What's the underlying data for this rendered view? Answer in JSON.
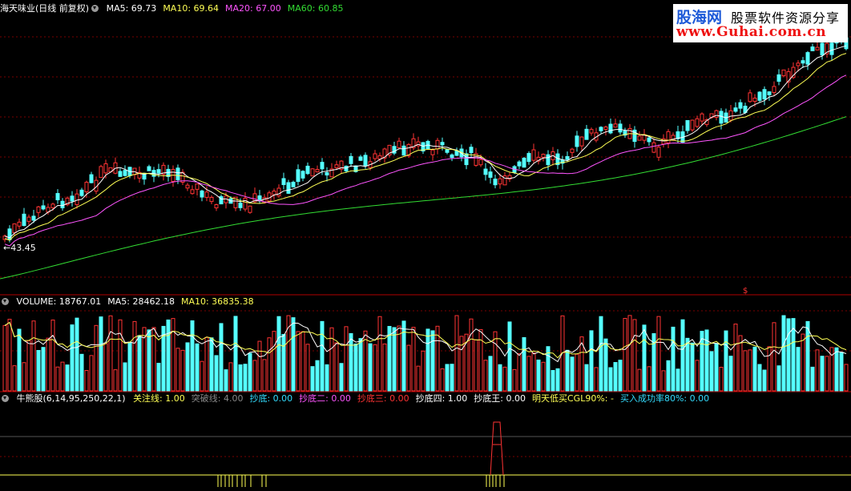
{
  "main_panel": {
    "stock_name": "海天味业(日线 前复权)",
    "indicators": [
      {
        "label": "MA5: 69.73",
        "color": "#ffffff"
      },
      {
        "label": "MA10: 69.64",
        "color": "#ffff55"
      },
      {
        "label": "MA20: 67.00",
        "color": "#ff55ff"
      },
      {
        "label": "MA60: 60.85",
        "color": "#33dd33"
      }
    ],
    "low_price_label": "←43.45"
  },
  "volume_panel": {
    "indicators": [
      {
        "label": "VOLUME: 18767.01",
        "color": "#ffffff"
      },
      {
        "label": "MA5: 28462.18",
        "color": "#ffffff"
      },
      {
        "label": "MA10: 36835.38",
        "color": "#ffff55"
      }
    ]
  },
  "custom_panel": {
    "title": "牛熊股(6,14,95,250,22,1)",
    "indicators": [
      {
        "label": "关注线: 1.00",
        "color": "#ffff55"
      },
      {
        "label": "突破线: 4.00",
        "color": "#888888"
      },
      {
        "label": "抄底: 0.00",
        "color": "#33ddff"
      },
      {
        "label": "抄底二: 0.00",
        "color": "#ff55ff"
      },
      {
        "label": "抄底三: 0.00",
        "color": "#ff3333"
      },
      {
        "label": "抄底四: 1.00",
        "color": "#ffffff"
      },
      {
        "label": "抄底王: 0.00",
        "color": "#ffffff"
      },
      {
        "label": "明天低买CGL90%: -",
        "color": "#ffff55"
      },
      {
        "label": "买入成功率80%: 0.00",
        "color": "#33ddff"
      }
    ]
  },
  "watermark": {
    "line1": "股海网",
    "line2": "股票软件资源分享",
    "line3": "www.Guhai.com.cn"
  },
  "colors": {
    "up_candle": "#ff3333",
    "down_candle": "#55ffff",
    "ma5": "#ffffff",
    "ma10": "#ffff55",
    "ma20": "#ff55ff",
    "ma60": "#33dd33",
    "grid": "#7a0000"
  }
}
